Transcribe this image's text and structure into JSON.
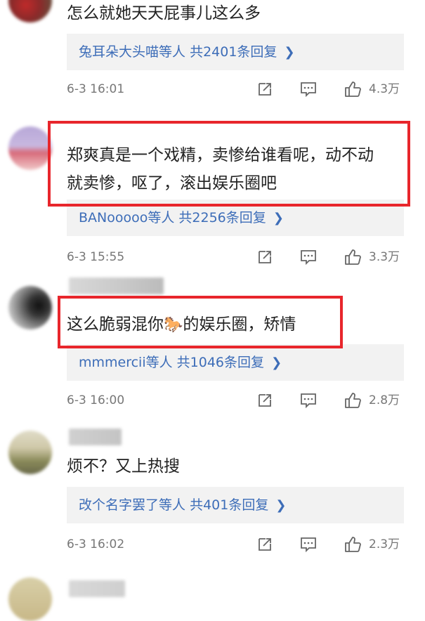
{
  "comments": [
    {
      "text": "怎么就她天天屁事儿这么多",
      "reply_who": "兔耳朵大头喵等人",
      "reply_count": "共2401条回复",
      "time": "6-3 16:01",
      "likes": "4.3万"
    },
    {
      "text_line1": "郑爽真是一个戏精，卖惨给谁看呢，动不动",
      "text_line2": "就卖惨，呕了，滚出娱乐圈吧",
      "reply_who": "BANooooo等人",
      "reply_count": "共2256条回复",
      "time": "6-3 15:55",
      "likes": "3.3万"
    },
    {
      "text_before": "这么脆弱混你",
      "emoji": "🐎",
      "text_after": "的娱乐圈，矫情",
      "reply_who": "mmmercii等人",
      "reply_count": "共1046条回复",
      "time": "6-3 16:00",
      "likes": "2.8万"
    },
    {
      "text": "烦不？又上热搜",
      "reply_who": "改个名字罢了等人",
      "reply_count": "共401条回复",
      "time": "6-3 16:02",
      "likes": "2.3万"
    }
  ],
  "icons": {
    "share": "share-icon",
    "comment": "comment-icon",
    "like": "thumbs-up-icon",
    "chevron": "chevron-right-icon"
  },
  "colors": {
    "highlight_border": "#e8262c",
    "reply_link": "#3d6db8",
    "reply_bg": "#f2f2f2",
    "meta_text": "#777777"
  }
}
